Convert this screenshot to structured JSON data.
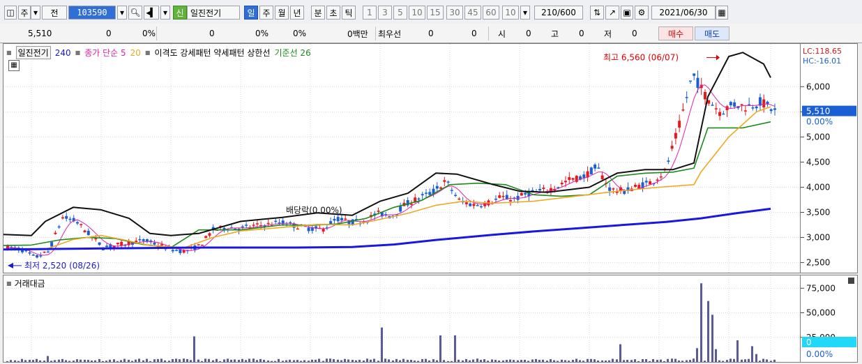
{
  "toolbar": {
    "jong": "주",
    "jeon": "전",
    "code": "103590",
    "sin": "신",
    "name": "일진전기",
    "periods": [
      "일",
      "주",
      "월",
      "년",
      "분",
      "초",
      "틱"
    ],
    "nums": [
      "1",
      "3",
      "5",
      "10",
      "15",
      "30",
      "45",
      "60"
    ],
    "n10": "10",
    "count": "210",
    "count_total": "/600",
    "date": "2021/06/30"
  },
  "quote": {
    "price": "5,510",
    "change": "0",
    "change_pct": "0%",
    "volume": "0",
    "vol_pct": "0%",
    "vol_pct2": "0%",
    "amount": "0백만",
    "best_label": "최우선",
    "best1": "0",
    "best2": "0",
    "si_label": "시",
    "si": "0",
    "go_label": "고",
    "go": "0",
    "jeo_label": "저",
    "jeo": "0",
    "buy": "매수",
    "sell": "매도"
  },
  "legend": {
    "name": "일진전기",
    "ma240": "240",
    "ma_label": "종가 단순 5",
    "ma20": "20",
    "rest": "이격도 강세패턴  약세패턴  상한선",
    "base": "기준선 26"
  },
  "lc_label": "LC:118.65",
  "hc_label": "HC:-16.01",
  "vol_title": "거래대금",
  "colors": {
    "up": "#e8191c",
    "down": "#1a5fd4",
    "ma240": "#1818e0",
    "ma20": "#f0a820",
    "ma5": "#e020a8",
    "base": "#1a8a1a",
    "upper": "#111111"
  },
  "chart_data": [
    {
      "type": "candlestick",
      "ylim": [
        2300,
        6850
      ],
      "y_ticks": [
        2500,
        3000,
        3500,
        4000,
        4500,
        5000,
        5500,
        6000
      ],
      "y_tick_labels": [
        "2,500",
        "3,000",
        "3,500",
        "4,000",
        "4,500",
        "5,000",
        "5,500",
        "6,000"
      ],
      "last_price": 5510,
      "last_label": "5,510",
      "last_pct": "0.00%",
      "anchors": [
        2800,
        2760,
        2600,
        2720,
        3400,
        3320,
        3050,
        2800,
        2850,
        2900,
        2940,
        2850,
        2760,
        2720,
        2830,
        3150,
        3200,
        3180,
        3230,
        3260,
        3300,
        3230,
        3180,
        3160,
        3380,
        3300,
        3330,
        3480,
        3420,
        3650,
        3780,
        3900,
        4120,
        3720,
        3650,
        3680,
        3800,
        3760,
        3880,
        3920,
        4000,
        4150,
        4200,
        4400,
        3950,
        3920,
        4020,
        4100,
        4320,
        5200,
        6250,
        5800,
        5500,
        5650,
        5600,
        5700,
        5510
      ],
      "ma240": {
        "x": [
          0,
          60,
          130,
          200,
          280,
          360,
          420,
          500,
          560,
          620,
          700,
          760,
          820,
          880,
          950,
          1000,
          1050,
          1100
        ],
        "y": [
          2760,
          2770,
          2780,
          2790,
          2800,
          2800,
          2800,
          2810,
          2860,
          2950,
          3050,
          3120,
          3180,
          3240,
          3310,
          3380,
          3480,
          3570
        ]
      },
      "ma20": {
        "x": [
          0,
          60,
          100,
          140,
          170,
          210,
          260,
          300,
          340,
          400,
          450,
          500,
          540,
          580,
          620,
          660,
          700,
          760,
          820,
          880,
          940,
          990,
          1000,
          1040,
          1080,
          1100
        ],
        "y": [
          2760,
          2760,
          2960,
          3040,
          2960,
          2840,
          2800,
          3000,
          3130,
          3200,
          3260,
          3250,
          3360,
          3480,
          3640,
          3720,
          3680,
          3720,
          3820,
          3920,
          4000,
          4050,
          4300,
          5000,
          5500,
          5600
        ]
      },
      "upper": {
        "x": [
          0,
          40,
          60,
          100,
          140,
          180,
          210,
          240,
          280,
          340,
          400,
          450,
          500,
          540,
          580,
          620,
          650,
          700,
          740,
          780,
          840,
          880,
          920,
          960,
          990,
          1010,
          1040,
          1060,
          1090,
          1100
        ],
        "y": [
          3060,
          3040,
          3320,
          3600,
          3550,
          3380,
          3080,
          3040,
          3080,
          3320,
          3400,
          3490,
          3440,
          3720,
          3880,
          4280,
          4260,
          4060,
          3920,
          3900,
          4000,
          4280,
          4350,
          4350,
          4480,
          5800,
          6600,
          6680,
          6450,
          6180
        ]
      },
      "base": {
        "x": [
          0,
          40,
          80,
          120,
          160,
          200,
          240,
          280,
          340,
          400,
          440,
          480,
          520,
          560,
          600,
          640,
          680,
          720,
          760,
          800,
          840,
          880,
          920,
          960,
          990,
          1010,
          1060,
          1100
        ],
        "y": [
          2840,
          2850,
          2950,
          3000,
          2980,
          2860,
          2800,
          3150,
          3150,
          3250,
          3240,
          3270,
          3380,
          3600,
          3740,
          4050,
          4080,
          4050,
          3850,
          3820,
          3850,
          4220,
          4280,
          4300,
          4380,
          5180,
          5180,
          5300
        ]
      },
      "annotations": [
        {
          "text": "최고 6,560 (06/07)",
          "x": 1010,
          "y": 6580
        },
        {
          "text": "최저 2,520 (08/26)",
          "x": 12,
          "y": 2440
        },
        {
          "text": "배당락(0.00%)",
          "x": 455,
          "y": 3540
        }
      ]
    },
    {
      "type": "bar",
      "title": "거래대금",
      "ylim": [
        0,
        88000
      ],
      "y_ticks": [
        25000,
        50000,
        75000
      ],
      "y_tick_labels": [
        "25,000",
        "50,000",
        "75,000"
      ],
      "last_label": "0",
      "last_pct": "0.00%",
      "spikes": [
        [
          48,
          3000
        ],
        [
          56,
          4000
        ],
        [
          65,
          6000
        ],
        [
          275,
          26000
        ],
        [
          543,
          35000
        ],
        [
          628,
          27000
        ],
        [
          650,
          27000
        ],
        [
          883,
          18000
        ],
        [
          995,
          14000
        ],
        [
          1000,
          80000
        ],
        [
          1012,
          62000
        ],
        [
          1018,
          48000
        ],
        [
          1024,
          13000
        ],
        [
          1052,
          22000
        ],
        [
          1074,
          16000
        ],
        [
          1080,
          8000
        ]
      ]
    }
  ]
}
